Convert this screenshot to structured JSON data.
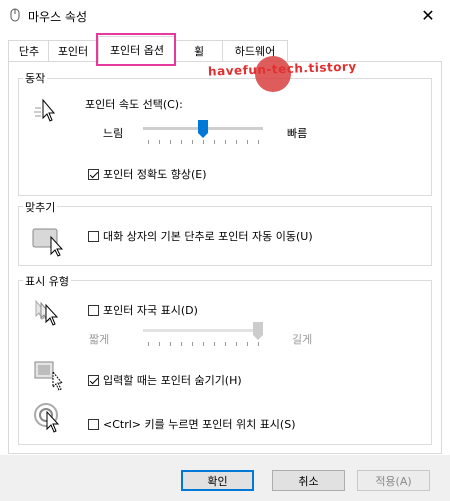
{
  "window": {
    "title": "마우스 속성",
    "close_glyph": "✕"
  },
  "tabs": [
    {
      "label": "단추"
    },
    {
      "label": "포인터"
    },
    {
      "label": "포인터 옵션",
      "active": true
    },
    {
      "label": "휠"
    },
    {
      "label": "하드웨어"
    }
  ],
  "watermark": {
    "text": "havefun-tech.tistory"
  },
  "motion": {
    "label": "동작",
    "speed_label": "포인터 속도 선택(C):",
    "slow_label": "느림",
    "fast_label": "빠름",
    "speed_value_fraction": 0.5,
    "precision_label": "포인터 정확도 향상(E)",
    "precision_checked": true
  },
  "snap": {
    "label": "맞추기",
    "snap_label": "대화 상자의 기본 단추로 포인터 자동 이동(U)",
    "snap_checked": false
  },
  "visibility": {
    "label": "표시 유형",
    "trails_label": "포인터 자국 표시(D)",
    "trails_checked": false,
    "short_label": "짧게",
    "long_label": "길게",
    "trails_value_fraction": 1.0,
    "hide_label": "입력할 때는 포인터 숨기기(H)",
    "hide_checked": true,
    "ctrl_label": "<Ctrl> 키를 누르면 포인터 위치 표시(S)",
    "ctrl_checked": false
  },
  "buttons": {
    "ok": "확인",
    "cancel": "취소",
    "apply": "적용(A)"
  },
  "colors": {
    "highlight": "#e6399b",
    "slider_thumb": "#0078d7",
    "default_button_border": "#0078d7"
  }
}
